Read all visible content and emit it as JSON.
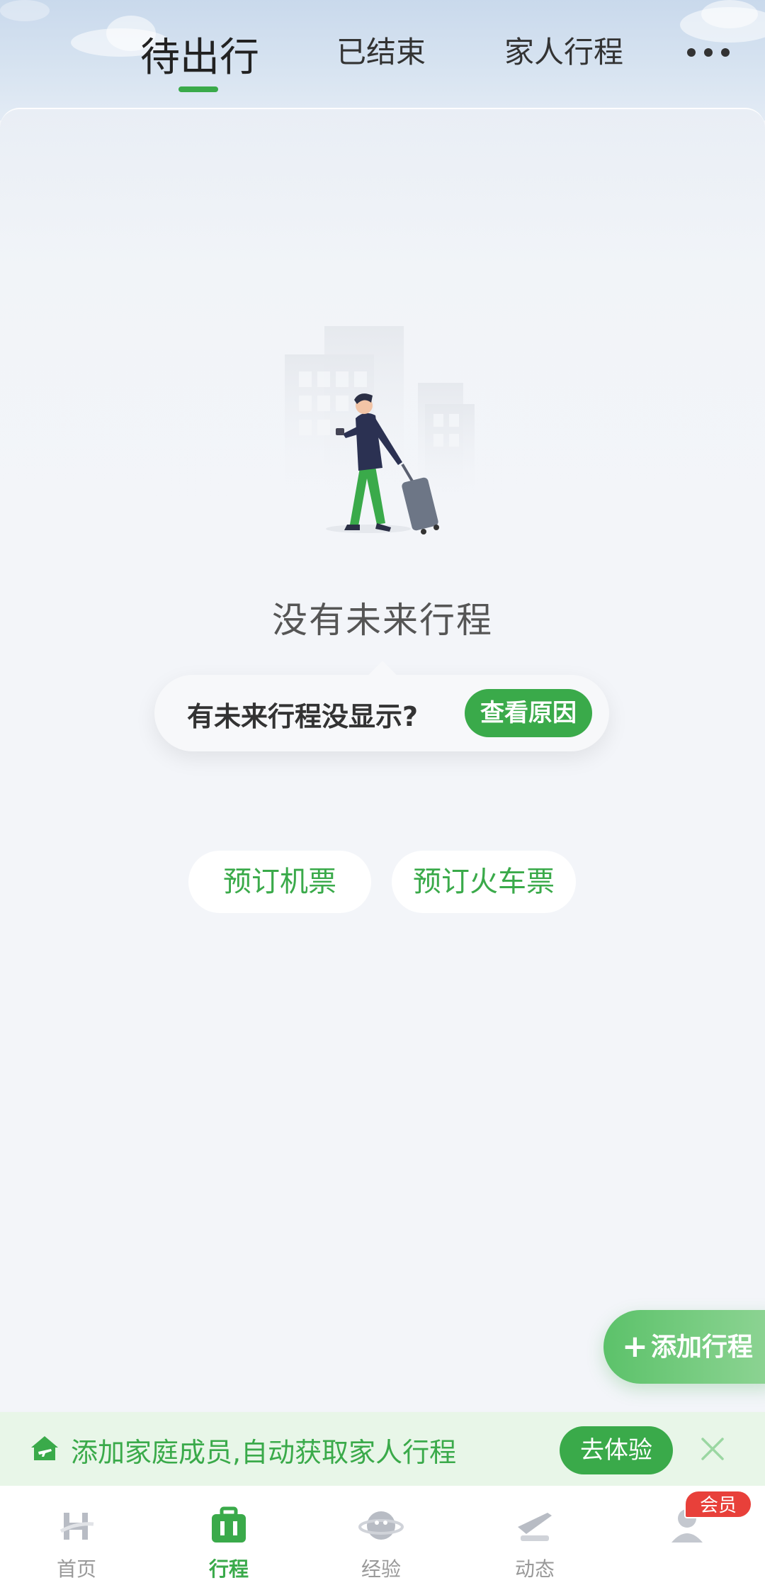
{
  "header": {
    "tabs": [
      {
        "label": "待出行",
        "active": true
      },
      {
        "label": "已结束",
        "active": false
      },
      {
        "label": "家人行程",
        "active": false
      }
    ],
    "more_icon": "more-dots-icon"
  },
  "empty_state": {
    "illustration_icon": "traveler-with-suitcase-illustration",
    "title": "没有未来行程",
    "prompt": {
      "text": "有未来行程没显示?",
      "button": "查看原因"
    }
  },
  "booking": {
    "flight": "预订机票",
    "train": "预订火车票"
  },
  "fab": {
    "icon": "plus-icon",
    "label": "添加行程"
  },
  "family_banner": {
    "icon": "home-plane-icon",
    "text": "添加家庭成员,自动获取家人行程",
    "button": "去体验",
    "close_icon": "close-icon"
  },
  "tabbar": {
    "items": [
      {
        "label": "首页",
        "icon": "home-icon",
        "active": false
      },
      {
        "label": "行程",
        "icon": "suitcase-icon",
        "active": true
      },
      {
        "label": "经验",
        "icon": "planet-icon",
        "active": false
      },
      {
        "label": "动态",
        "icon": "flight-status-icon",
        "active": false
      },
      {
        "label": "",
        "icon": "profile-icon",
        "active": false
      }
    ],
    "vip_badge": "会员"
  },
  "colors": {
    "accent": "#3aaa4a",
    "background": "#f3f5f9",
    "banner_bg": "#e8f6e8",
    "badge_red": "#e8403a"
  }
}
